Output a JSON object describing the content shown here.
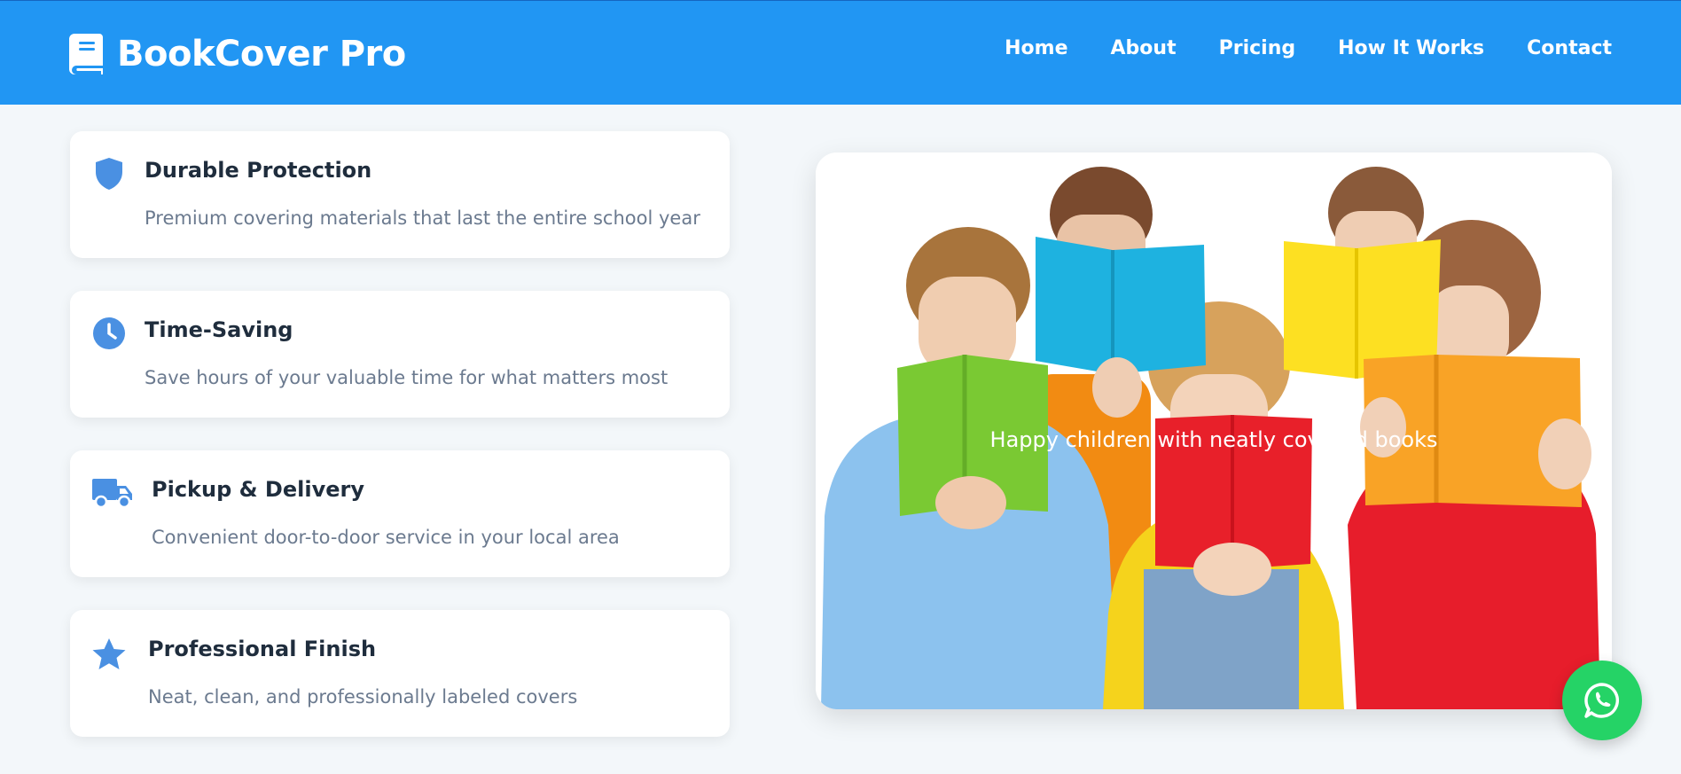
{
  "brand": {
    "name": "BookCover Pro",
    "icon": "book-icon"
  },
  "nav": {
    "items": [
      {
        "label": "Home"
      },
      {
        "label": "About"
      },
      {
        "label": "Pricing"
      },
      {
        "label": "How It Works"
      },
      {
        "label": "Contact"
      }
    ]
  },
  "features": [
    {
      "icon": "shield-icon",
      "title": "Durable Protection",
      "description": "Premium covering materials that last the entire school year"
    },
    {
      "icon": "clock-icon",
      "title": "Time-Saving",
      "description": "Save hours of your valuable time for what matters most"
    },
    {
      "icon": "truck-icon",
      "title": "Pickup & Delivery",
      "description": "Convenient door-to-door service in your local area"
    },
    {
      "icon": "star-icon",
      "title": "Professional Finish",
      "description": "Neat, clean, and professionally labeled covers"
    }
  ],
  "hero": {
    "caption": "Happy children with neatly covered books"
  },
  "whatsapp": {
    "icon": "whatsapp-icon"
  },
  "colors": {
    "primary": "#2196f3",
    "icon": "#4a90e2",
    "whatsapp": "#25d366"
  }
}
